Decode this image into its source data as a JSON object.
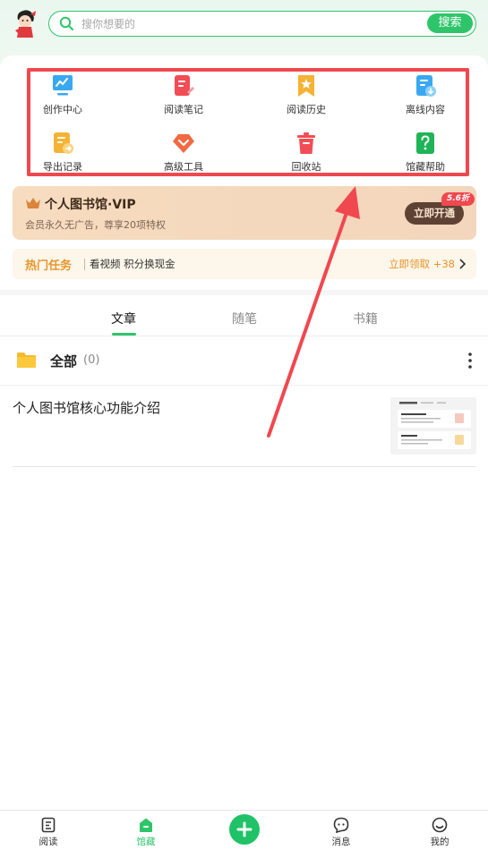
{
  "header": {
    "search_placeholder": "搜你想要的",
    "search_button": "搜索"
  },
  "functions": [
    {
      "label": "创作中心",
      "icon": "creation-center-icon"
    },
    {
      "label": "阅读笔记",
      "icon": "reading-notes-icon"
    },
    {
      "label": "阅读历史",
      "icon": "reading-history-icon"
    },
    {
      "label": "离线内容",
      "icon": "offline-content-icon"
    },
    {
      "label": "导出记录",
      "icon": "export-records-icon"
    },
    {
      "label": "高级工具",
      "icon": "advanced-tools-icon"
    },
    {
      "label": "回收站",
      "icon": "recycle-bin-icon"
    },
    {
      "label": "馆藏帮助",
      "icon": "library-help-icon"
    }
  ],
  "vip": {
    "title": "个人图书馆·VIP",
    "subtitle": "会员永久无广告，尊享20项特权",
    "button": "立即开通",
    "badge": "5.6折"
  },
  "tasks": {
    "title": "热门任务",
    "desc": "看视频 积分换现金",
    "link": "立即领取 +38"
  },
  "tabs": [
    {
      "label": "文章",
      "active": true
    },
    {
      "label": "随笔",
      "active": false
    },
    {
      "label": "书籍",
      "active": false
    }
  ],
  "folder": {
    "label": "全部",
    "count": "(0)"
  },
  "article": {
    "title": "个人图书馆核心功能介绍"
  },
  "bottom_nav": [
    {
      "label": "阅读",
      "active": false
    },
    {
      "label": "馆藏",
      "active": true
    },
    {
      "label": "",
      "active": false
    },
    {
      "label": "消息",
      "active": false
    },
    {
      "label": "我的",
      "active": false
    }
  ],
  "colors": {
    "accent": "#2ec56a",
    "highlight": "#f0484f",
    "vip_bg": "#f7dcc0",
    "task_accent": "#e8962b"
  }
}
